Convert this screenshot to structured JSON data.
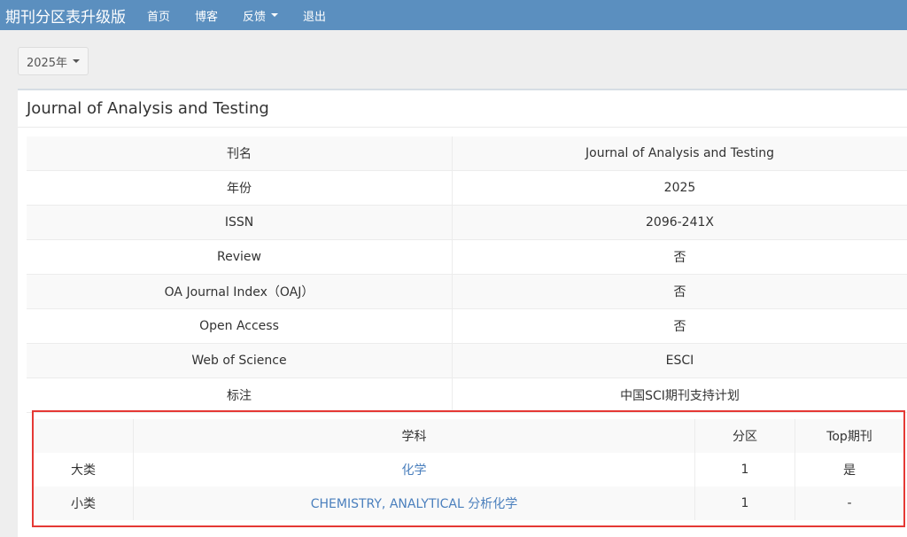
{
  "nav": {
    "brand": "期刊分区表升级版",
    "items": [
      "首页",
      "博客",
      "反馈",
      "退出"
    ]
  },
  "year_select": {
    "label": "2025年"
  },
  "journal": {
    "title": "Journal of Analysis and Testing",
    "rows": [
      {
        "label": "刊名",
        "value": "Journal of Analysis and Testing"
      },
      {
        "label": "年份",
        "value": "2025"
      },
      {
        "label": "ISSN",
        "value": "2096-241X"
      },
      {
        "label": "Review",
        "value": "否"
      },
      {
        "label": "OA Journal Index（OAJ）",
        "value": "否"
      },
      {
        "label": "Open Access",
        "value": "否"
      },
      {
        "label": "Web of Science",
        "value": "ESCI"
      },
      {
        "label": "标注",
        "value": "中国SCI期刊支持计划"
      }
    ]
  },
  "subjects": {
    "headers": [
      "",
      "学科",
      "分区",
      "Top期刊"
    ],
    "rows": [
      {
        "type": "大类",
        "subject": "化学",
        "zone": "1",
        "top": "是"
      },
      {
        "type": "小类",
        "subject": "CHEMISTRY, ANALYTICAL 分析化学",
        "zone": "1",
        "top": "-"
      }
    ]
  },
  "colors": {
    "navbar": "#5b8fbf",
    "link": "#4a7fbd",
    "highlight_border": "#e53935"
  }
}
